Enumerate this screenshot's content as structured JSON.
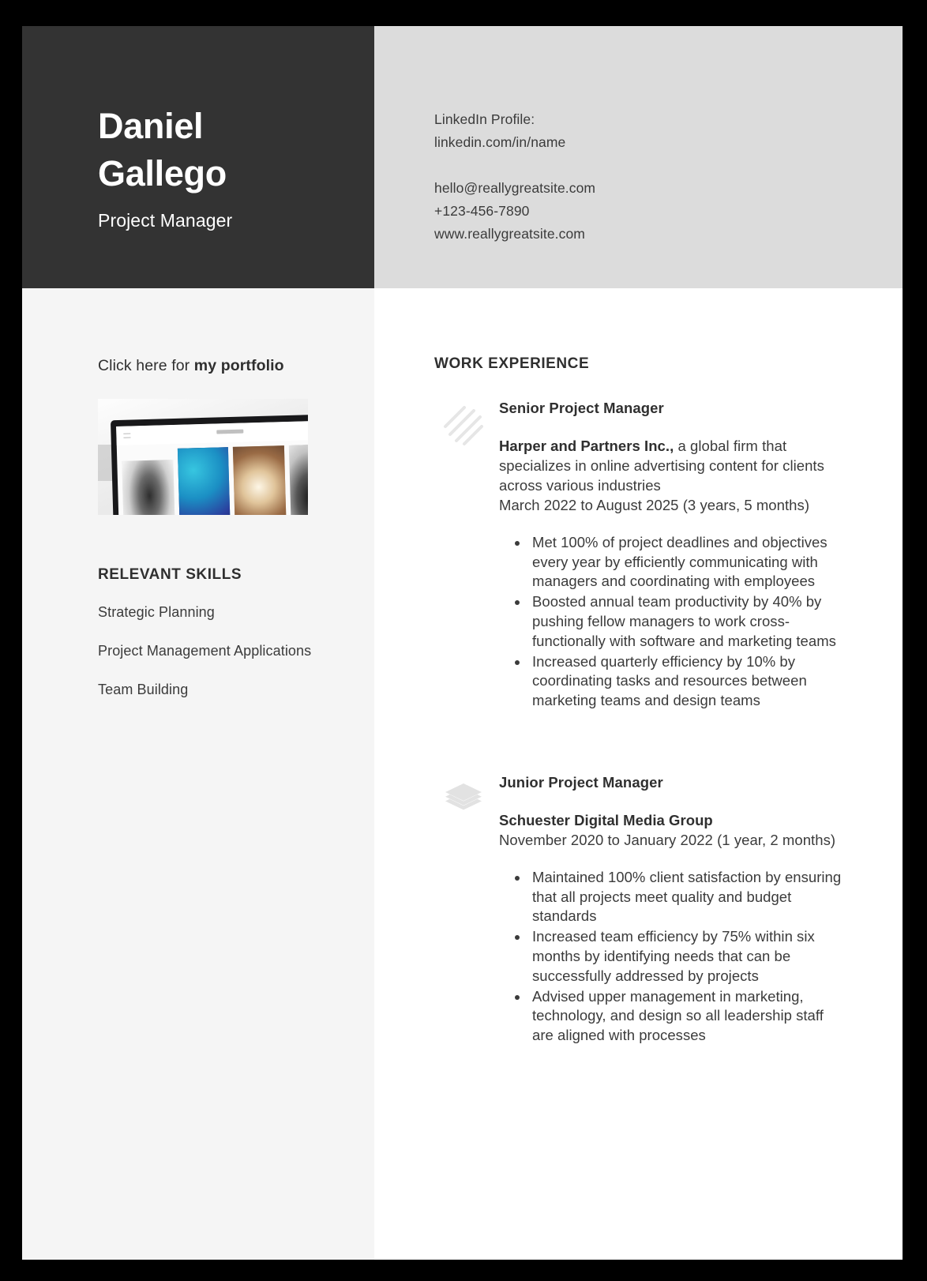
{
  "header": {
    "name": "Daniel Gallego",
    "title": "Project Manager",
    "contact": {
      "linkedin_label": "LinkedIn Profile:",
      "linkedin_url": "linkedin.com/in/name",
      "email": "hello@reallygreatsite.com",
      "phone": "+123-456-7890",
      "website": "www.reallygreatsite.com"
    }
  },
  "sidebar": {
    "portfolio": {
      "prefix": "Click here for ",
      "link_text": "my portfolio",
      "thumbnail_name": "portfolio-website-screenshot"
    },
    "skills_heading": "RELEVANT SKILLS",
    "skills": [
      "Strategic Planning",
      "Project Management Applications",
      "Team Building"
    ]
  },
  "main": {
    "work_heading": "WORK EXPERIENCE",
    "jobs": [
      {
        "icon": "diagonal-streaks-icon",
        "role": "Senior Project Manager",
        "company": "Harper and Partners Inc.,",
        "company_description": " a global firm that specializes in online advertising content for clients across various industries",
        "dates": "March 2022 to August 2025 (3 years, 5 months)",
        "bullets": [
          "Met 100% of project deadlines and objectives every year by efficiently communicating with managers and coordinating with employees",
          "Boosted annual team productivity by 40% by pushing fellow managers to work cross-functionally with software and marketing teams",
          "Increased quarterly efficiency by 10% by coordinating tasks and resources between marketing teams and design teams"
        ]
      },
      {
        "icon": "layers-stack-icon",
        "role": "Junior Project Manager",
        "company": "Schuester Digital Media Group",
        "company_description": "",
        "dates": "November 2020 to January 2022 (1 year, 2 months)",
        "bullets": [
          "Maintained 100% client satisfaction by ensuring that all projects meet quality and budget standards",
          "Increased team efficiency by 75% within six months by identifying needs that can be successfully addressed by projects",
          "Advised upper management in marketing, technology, and design so all leadership staff are aligned with processes"
        ]
      }
    ]
  },
  "colors": {
    "header_dark": "#333333",
    "header_light": "#dcdcdc",
    "sidebar_bg": "#f5f5f5",
    "main_bg": "#ffffff",
    "text_dark": "#2f2f2f",
    "text_body": "#3b3b3b",
    "icon_gray": "#e2e2e2",
    "page_border": "#000000"
  }
}
